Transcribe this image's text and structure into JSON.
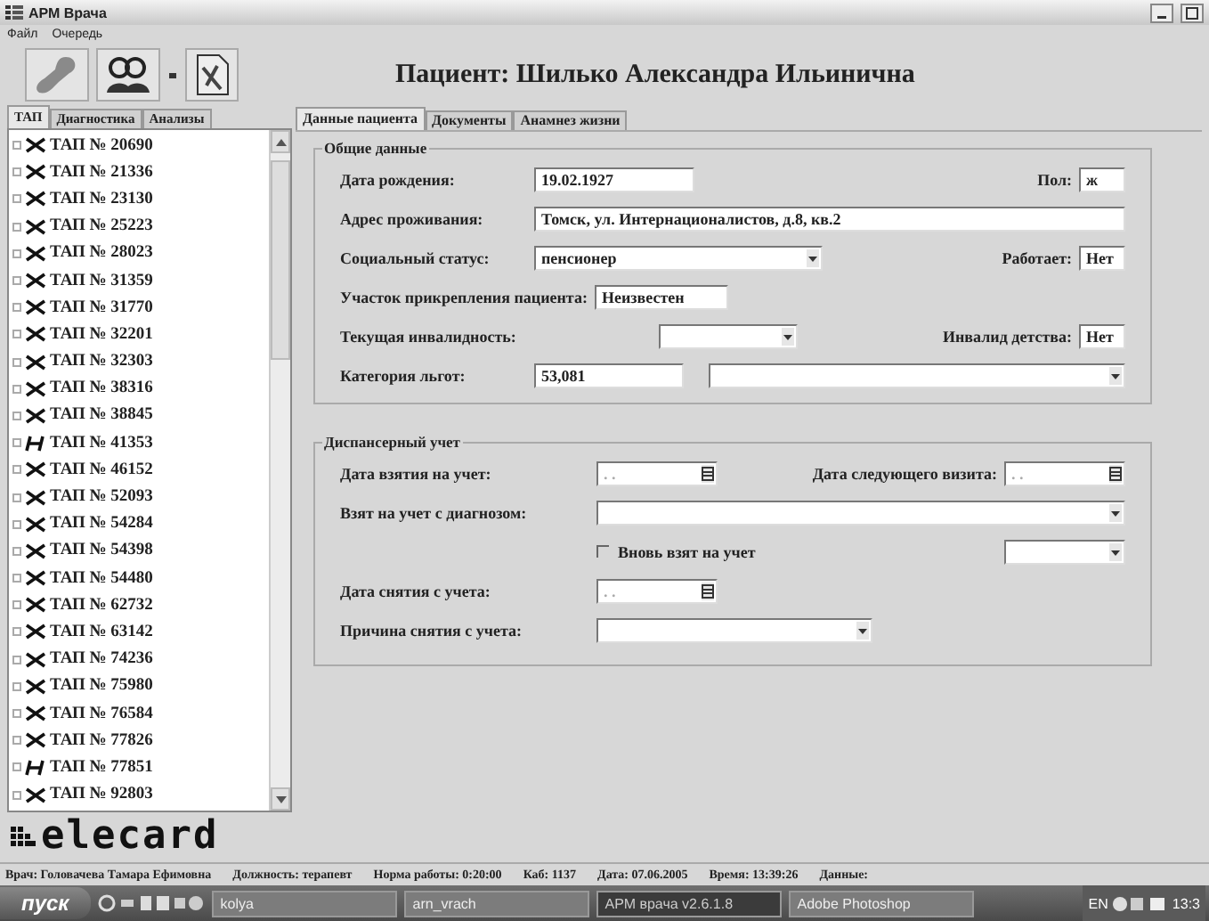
{
  "window": {
    "title": "АРМ Врача"
  },
  "menu": [
    "Файл",
    "Очередь"
  ],
  "patient_title": "Пациент: Шилько Александра Ильинична",
  "left_tabs": [
    {
      "label": "ТАП",
      "selected": true
    },
    {
      "label": "Диагностика",
      "selected": false
    },
    {
      "label": "Анализы",
      "selected": false
    }
  ],
  "tree": [
    {
      "label": "ТАП № 20690",
      "kind": "x"
    },
    {
      "label": "ТАП № 21336",
      "kind": "x"
    },
    {
      "label": "ТАП № 23130",
      "kind": "x"
    },
    {
      "label": "ТАП № 25223",
      "kind": "x"
    },
    {
      "label": "ТАП № 28023",
      "kind": "x"
    },
    {
      "label": "ТАП № 31359",
      "kind": "x"
    },
    {
      "label": "ТАП № 31770",
      "kind": "x"
    },
    {
      "label": "ТАП № 32201",
      "kind": "x"
    },
    {
      "label": "ТАП № 32303",
      "kind": "x"
    },
    {
      "label": "ТАП № 38316",
      "kind": "x"
    },
    {
      "label": "ТАП № 38845",
      "kind": "x"
    },
    {
      "label": "ТАП № 41353",
      "kind": "h"
    },
    {
      "label": "ТАП № 46152",
      "kind": "x"
    },
    {
      "label": "ТАП № 52093",
      "kind": "x"
    },
    {
      "label": "ТАП № 54284",
      "kind": "x"
    },
    {
      "label": "ТАП № 54398",
      "kind": "x"
    },
    {
      "label": "ТАП № 54480",
      "kind": "x"
    },
    {
      "label": "ТАП № 62732",
      "kind": "x"
    },
    {
      "label": "ТАП № 63142",
      "kind": "x"
    },
    {
      "label": "ТАП № 74236",
      "kind": "x"
    },
    {
      "label": "ТАП № 75980",
      "kind": "x"
    },
    {
      "label": "ТАП № 76584",
      "kind": "x"
    },
    {
      "label": "ТАП № 77826",
      "kind": "x"
    },
    {
      "label": "ТАП № 77851",
      "kind": "h"
    },
    {
      "label": "ТАП № 92803",
      "kind": "x"
    }
  ],
  "logo": "elecard",
  "main_tabs": [
    {
      "label": "Данные пациента",
      "selected": true
    },
    {
      "label": "Документы",
      "selected": false
    },
    {
      "label": "Анамнез жизни",
      "selected": false
    }
  ],
  "general": {
    "title": "Общие данные",
    "birth_date": {
      "label": "Дата рождения:",
      "value": "19.02.1927"
    },
    "sex": {
      "label": "Пол:",
      "value": "ж"
    },
    "address": {
      "label": "Адрес проживания:",
      "value": "Томск, ул. Интернационалистов, д.8, кв.2"
    },
    "social_status": {
      "label": "Социальный статус:",
      "value": "пенсионер"
    },
    "works": {
      "label": "Работает:",
      "value": "Нет"
    },
    "district": {
      "label": "Участок прикрепления пациента:",
      "value": "Неизвестен"
    },
    "disability": {
      "label": "Текущая инвалидность:"
    },
    "child_disability": {
      "label": "Инвалид детства:",
      "value": "Нет"
    },
    "benefit_category": {
      "label": "Категория льгот:",
      "value": "53,081"
    }
  },
  "dispensary": {
    "title": "Диспансерный учет",
    "date_taken": {
      "label": "Дата взятия на учет:",
      "placeholder": ". ."
    },
    "next_visit": {
      "label": "Дата следующего визита:",
      "placeholder": ". ."
    },
    "diagnosis": {
      "label": "Взят на учет с диагнозом:"
    },
    "retaken": {
      "label": "Вновь взят на учет",
      "checked": false
    },
    "removal_date": {
      "label": "Дата снятия с учета:",
      "placeholder": ". ."
    },
    "removal_reason": {
      "label": "Причина снятия с учета:"
    }
  },
  "status_bar": [
    "Врач: Головачева Тамара Ефимовна",
    "Должность: терапевт",
    "Норма работы: 0:20:00",
    "Каб: 1137",
    "Дата: 07.06.2005",
    "Время: 13:39:26",
    "Данные:"
  ],
  "taskbar": {
    "start": "пуск",
    "buttons": [
      {
        "label": "kolya",
        "selected": false
      },
      {
        "label": "arn_vrach",
        "selected": false
      },
      {
        "label": "АРМ врача v2.6.1.8",
        "selected": true
      },
      {
        "label": "Adobe Photoshop",
        "selected": false
      }
    ],
    "language": "EN",
    "clock": "13:3"
  }
}
